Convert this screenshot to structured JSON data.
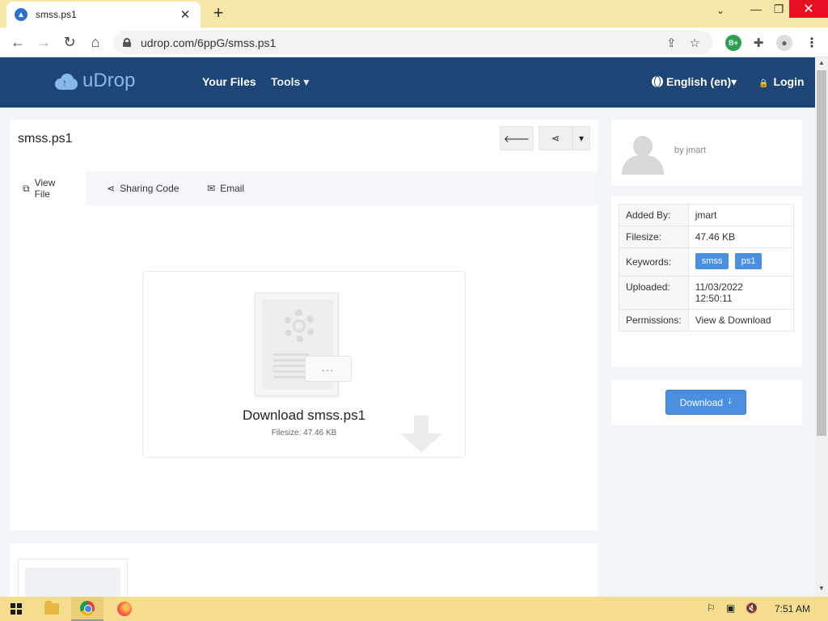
{
  "browser": {
    "tab_title": "smss.ps1",
    "url": "udrop.com/6ppG/smss.ps1",
    "new_tab_icon": "plus-icon",
    "extension_badge": "B+"
  },
  "site": {
    "logo_text": "uDrop",
    "nav": {
      "your_files": "Your Files",
      "tools": "Tools",
      "language": "English (en)",
      "login": "Login"
    }
  },
  "file": {
    "title": "smss.ps1",
    "tabs": [
      {
        "label": "View File",
        "icon": "preview-icon"
      },
      {
        "label": "Sharing Code",
        "icon": "share-icon"
      },
      {
        "label": "Email",
        "icon": "envelope-icon"
      }
    ],
    "download_title": "Download smss.ps1",
    "filesize_line": "Filesize: 47.46 KB",
    "preview_dots": "..."
  },
  "sidebar": {
    "by_user": "by jmart",
    "info": {
      "added_by_label": "Added By:",
      "added_by_value": "jmart",
      "filesize_label": "Filesize:",
      "filesize_value": "47.46 KB",
      "keywords_label": "Keywords:",
      "keywords": [
        "smss",
        "ps1"
      ],
      "uploaded_label": "Uploaded:",
      "uploaded_date": "11/03/2022",
      "uploaded_time": "12:50:11",
      "permissions_label": "Permissions:",
      "permissions_value": "View & Download"
    },
    "download_button": "Download"
  },
  "taskbar": {
    "time": "7:51 AM"
  },
  "colors": {
    "header_bg": "#1d4676",
    "accent_blue": "#4a8fe0",
    "logo_blue": "#87b8ec",
    "tabstrip_bg": "#f6e7a8",
    "taskbar_bg": "#f4dd8e"
  }
}
